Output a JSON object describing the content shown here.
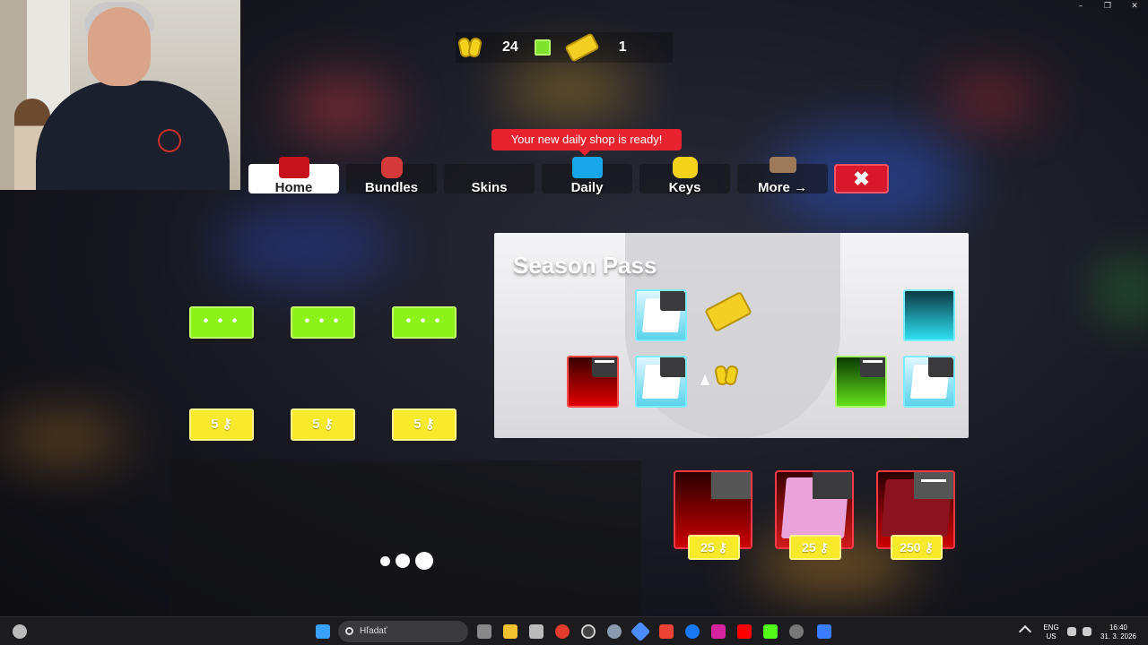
{
  "window": {
    "minimize": "–",
    "restore": "❐",
    "close": "✕"
  },
  "currency": {
    "keys": "24",
    "tickets": "1",
    "icons": [
      "key-icon",
      "plus-icon",
      "ticket-icon"
    ]
  },
  "notification": "Your new daily shop is ready!",
  "tabs": [
    {
      "label": "Home",
      "icon": "home-icon",
      "active": true
    },
    {
      "label": "Bundles",
      "icon": "bundles-icon"
    },
    {
      "label": "Skins",
      "icon": ""
    },
    {
      "label": "Daily",
      "icon": "daily-icon"
    },
    {
      "label": "Keys",
      "icon": "key-icon"
    },
    {
      "label": "More →",
      "icon": "more-icon"
    }
  ],
  "close_label": "✖",
  "dot_buttons": [
    "• • •",
    "• • •",
    "• • •"
  ],
  "key_buttons": [
    "5 ⚷",
    "5 ⚷",
    "5 ⚷"
  ],
  "season_pass": {
    "title": "Season Pass"
  },
  "shop_items": [
    {
      "price": "25 ⚷",
      "color": "#c40000"
    },
    {
      "price": "25 ⚷",
      "color": "#e7a3d8"
    },
    {
      "price": "250 ⚷",
      "color": "#8b1320"
    }
  ],
  "taskbar": {
    "search_placeholder": "Hľadať",
    "lang_top": "ENG",
    "lang_bottom": "US",
    "time": "16:40",
    "date": "31. 3. 2026"
  },
  "colors": {
    "accent_green": "#8cf21a",
    "accent_yellow": "#f7ea2b",
    "accent_red": "#e8232f"
  }
}
